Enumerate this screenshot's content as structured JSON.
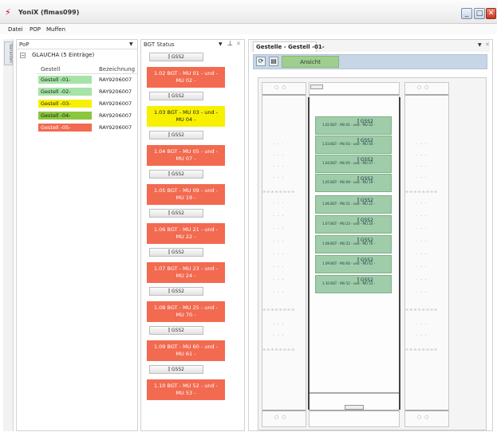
{
  "window": {
    "title": "YoniX (fimas099)"
  },
  "menu": [
    "Datei",
    "POP",
    "Muffen"
  ],
  "side_strip_label": "Varianten",
  "pop_panel": {
    "title": "PoP",
    "tree_label": "GLAUCHA  (5 Einträge)",
    "columns": [
      "Gestell",
      "Bezeichnung"
    ],
    "rows": [
      {
        "gestell": "Gestell -01-",
        "bezeichnung": "RAY9206007",
        "color": "#a6e3a6"
      },
      {
        "gestell": "Gestell -02-",
        "bezeichnung": "RAY9206007",
        "color": "#a6e3a6"
      },
      {
        "gestell": "Gestell -03-",
        "bezeichnung": "RAY9206007",
        "color": "#f7f000"
      },
      {
        "gestell": "Gestell -04-",
        "bezeichnung": "RAY9206007",
        "color": "#8cc63f"
      },
      {
        "gestell": "Gestell -05-",
        "bezeichnung": "RAY9206007",
        "color": "#f26a50"
      }
    ]
  },
  "bgt_panel": {
    "title": "BGT Status",
    "groups": [
      {
        "label": "GSS2",
        "line1": "1.02 BGT - MU 01 - und -",
        "line2": "MU 02 -",
        "color": "#f26a50"
      },
      {
        "label": "GSS2",
        "line1": "1.03 BGT - MU 03 - und -",
        "line2": "MU 04 -",
        "color": "#f7f000"
      },
      {
        "label": "GSS2",
        "line1": "1.04 BGT - MU 05 - und -",
        "line2": "MU 07 -",
        "color": "#f26a50"
      },
      {
        "label": "GSS2",
        "line1": "1.05 BGT - MU 09 - und -",
        "line2": "MU 19 -",
        "color": "#f26a50"
      },
      {
        "label": "GSS2",
        "line1": "1.06 BGT - MU 21 - und -",
        "line2": "MU 22 -",
        "color": "#f26a50"
      },
      {
        "label": "GSS2",
        "line1": "1.07 BGT - MU 23 - und -",
        "line2": "MU 24 -",
        "color": "#f26a50"
      },
      {
        "label": "GSS2",
        "line1": "1.08 BGT - MU 25 - und -",
        "line2": "MU 70 -",
        "color": "#f26a50"
      },
      {
        "label": "GSS2",
        "line1": "1.09 BGT - MU 60 - und -",
        "line2": "MU 61 -",
        "color": "#f26a50"
      },
      {
        "label": "GSS2",
        "line1": "1.10 BGT - MU 52 - und -",
        "line2": "MU 53 -",
        "color": "#f26a50"
      }
    ]
  },
  "gestelle_panel": {
    "tab_title": "Gestelle - Gestell -01-",
    "view_button": "Ansicht",
    "mounts": [
      {
        "tag": "GSS2",
        "label": "1.02 BGT - MU 01 - und - MU 02 -"
      },
      {
        "tag": "GSS2",
        "label": "1.03 BGT - MU 03 - und - MU 04 -"
      },
      {
        "tag": "GSS2",
        "label": "1.04 BGT - MU 05 - und - MU 07 -"
      },
      {
        "tag": "GSS2",
        "label": "1.05 BGT - MU 09 - und - MU 19 -"
      },
      {
        "tag": "GSS2",
        "label": "1.06 BGT - MU 21 - und - MU 22 -"
      },
      {
        "tag": "GSS2",
        "label": "1.07 BGT - MU 23 - und - MU 24 -"
      },
      {
        "tag": "GSS2",
        "label": "1.08 BGT - MU 25 - und - MU 70 -"
      },
      {
        "tag": "GSS2",
        "label": "1.09 BGT - MU 60 - und - MU 61 -"
      },
      {
        "tag": "GSS2",
        "label": "1.10 BGT - MU 52 - und - MU 53 -"
      }
    ]
  }
}
